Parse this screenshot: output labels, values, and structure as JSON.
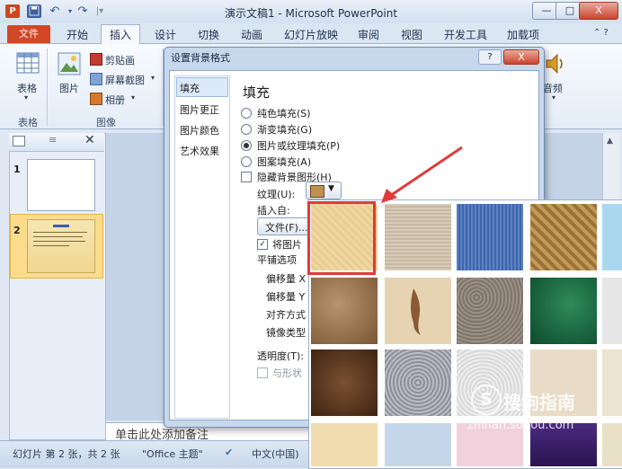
{
  "window": {
    "title": "演示文稿1 - Microsoft PowerPoint",
    "app_icon": "P",
    "minimize": "—",
    "maximize": "□",
    "close": "X"
  },
  "ribbon_tabs": [
    "文件",
    "开始",
    "插入",
    "设计",
    "切换",
    "动画",
    "幻灯片放映",
    "审阅",
    "视图",
    "开发工具",
    "加载项"
  ],
  "ribbon": {
    "table_label": "表格",
    "picture_label": "图片",
    "clipart_label": "剪贴画",
    "screenshot_label": "屏幕截图",
    "album_label": "相册",
    "audio_label": "音频",
    "group_table": "表格",
    "group_image": "图像"
  },
  "left_pane": {
    "slide1_num": "1",
    "slide2_num": "2"
  },
  "dialog": {
    "title": "设置背景格式",
    "help": "?",
    "close": "X",
    "nav_items": [
      "填充",
      "图片更正",
      "图片颜色",
      "艺术效果"
    ],
    "heading": "填充",
    "options": [
      "纯色填充(S)",
      "渐变填充(G)",
      "图片或纹理填充(P)",
      "图案填充(A)"
    ],
    "hide_bg": "隐藏背景图形(H)",
    "texture_label": "纹理(U):",
    "insert_from": "插入自:",
    "file_button": "文件(F)...",
    "tile_checkbox": "将图片",
    "tile_options": "平铺选项",
    "offset_x": "偏移量 X",
    "offset_y": "偏移量 Y",
    "alignment": "对齐方式",
    "mirror": "镜像类型",
    "transparency": "透明度(T):",
    "rotate_with_shape": "与形状"
  },
  "status_bar": {
    "slide_info": "幻灯片 第 2 张，共 2 张",
    "theme": "\"Office 主题\"",
    "language": "中文(中国)"
  },
  "notes_placeholder": "单击此处添加备注",
  "watermark": {
    "brand": "搜狗指南",
    "url": "zhinan.sogou.com"
  },
  "colors": {
    "file_tab": "#d24726",
    "selection_box": "#e03a3a",
    "arrow": "#e03a3a"
  }
}
